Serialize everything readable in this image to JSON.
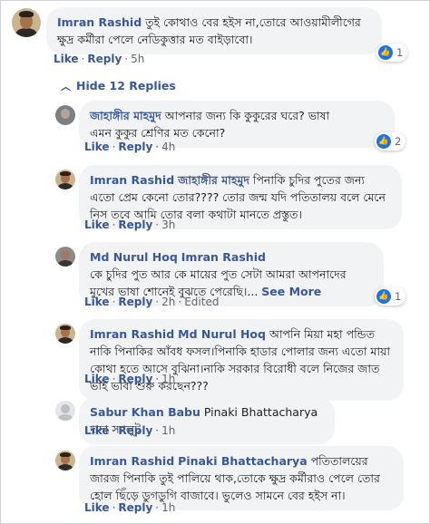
{
  "top_comment": {
    "author": "Imran Rashid",
    "text": "তুই কোথাও বের হইস না,তোরে আওয়ামীলীগের ক্ষুদ্র কর্মীরা পেলে নেডিকুত্তার মত বাইড়াবো।",
    "like": "Like",
    "reply": "Reply",
    "time": "5h",
    "reactions": "1"
  },
  "hide_replies": "Hide 12 Replies",
  "replies": [
    {
      "author": "জাহাঙ্গীর মাহমুদ",
      "text": "আপনার জন্য কি কুকুরের ঘরে? ভাষা এমন কুকুর শ্রেণির মত কেনো?",
      "like": "Like",
      "reply": "Reply",
      "time": "4h",
      "reactions": "2"
    },
    {
      "author": "Imran Rashid",
      "mention": "জাহাঙ্গীর মাহমুদ",
      "text": "পিনাকি চুদির পুতের জন্য এতো প্রেম কেনো তোর???? তোর জন্ম যদি পতিতালয় বলে মেনে নিস তবে আমি তোর বলা কথাটা মানতে প্রস্তুত।",
      "like": "Like",
      "reply": "Reply",
      "time": "3h"
    },
    {
      "author": "Md Nurul Hoq",
      "mention": "Imran Rashid",
      "text": "কে চুদির পুত আর কে মায়ের পুত সেটা আমরা আপনাদের মুখের ভাষা শোনেই বুঝতে পেরেছি।...",
      "see_more": "See More",
      "like": "Like",
      "reply": "Reply",
      "time": "2h",
      "edited": "Edited",
      "reactions": "1"
    },
    {
      "author": "Imran Rashid",
      "mention": "Md Nurul Hoq",
      "text": "আপনি মিয়া মহা পন্ডিত নাকি পিনাকির আঁবধ ফসল।পিনাকি হাডার পোলার জন্য এতো মায়া কোথা হতে আসে বুঝিনা।নাকি সরকার বিরোধী বলে নিজের জাত ভাই ভাবা শুরু করছেন???",
      "like": "Like",
      "reply": "Reply",
      "time": "1h"
    },
    {
      "author": "Sabur Khan Babu",
      "text": "Pinaki Bhattacharya দাদা স্যালুট",
      "like": "Like",
      "reply": "Reply",
      "time": "1h"
    },
    {
      "author": "Imran Rashid",
      "mention": "Pinaki Bhattacharya",
      "text": "পতিতালয়ের জারজ পিনাকি তুই পালিয়ে থাক,তোকে ক্ষুদ্র কর্মীরাও পেলে তোর হোল ছিঁড়ে ডুগডুগি বাজাবে। ভুলেও সামনে বের হইস না।",
      "like": "Like",
      "reply": "Reply",
      "time": "1h"
    }
  ],
  "colors": {
    "link_blue": "#385898",
    "bubble_bg": "#f2f3f5",
    "meta_gray": "#606770",
    "like_blue": "#1b74e4"
  },
  "icons": {
    "reaction": "thumbs-up-icon",
    "collapse": "chevron-up-icon"
  }
}
